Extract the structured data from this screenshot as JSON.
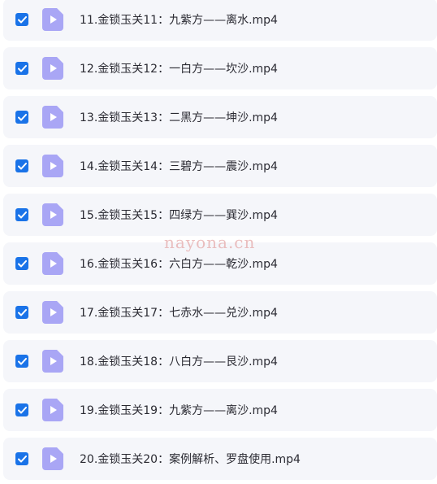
{
  "files": [
    {
      "name": "11.金锁玉关11：九紫方——离水.mp4",
      "checked": true
    },
    {
      "name": "12.金锁玉关12：一白方——坎沙.mp4",
      "checked": true
    },
    {
      "name": "13.金锁玉关13：二黑方——坤沙.mp4",
      "checked": true
    },
    {
      "name": "14.金锁玉关14：三碧方——震沙.mp4",
      "checked": true
    },
    {
      "name": "15.金锁玉关15：四绿方——巽沙.mp4",
      "checked": true
    },
    {
      "name": "16.金锁玉关16：六白方——乾沙.mp4",
      "checked": true
    },
    {
      "name": "17.金锁玉关17：七赤水——兑沙.mp4",
      "checked": true
    },
    {
      "name": "18.金锁玉关18：八白方——艮沙.mp4",
      "checked": true
    },
    {
      "name": "19.金锁玉关19：九紫方——离沙.mp4",
      "checked": true
    },
    {
      "name": "20.金锁玉关20：案例解析、罗盘使用.mp4",
      "checked": true
    }
  ],
  "watermark": "nayona.cn",
  "icons": {
    "checkbox": "checkbox-checked-icon",
    "file": "video-file-icon"
  },
  "colors": {
    "checkbox": "#1a73e8",
    "file_icon": "#a9a6f5",
    "row_bg": "#f5f6fa",
    "text": "#2b2b33",
    "watermark": "#e8b4b4"
  }
}
